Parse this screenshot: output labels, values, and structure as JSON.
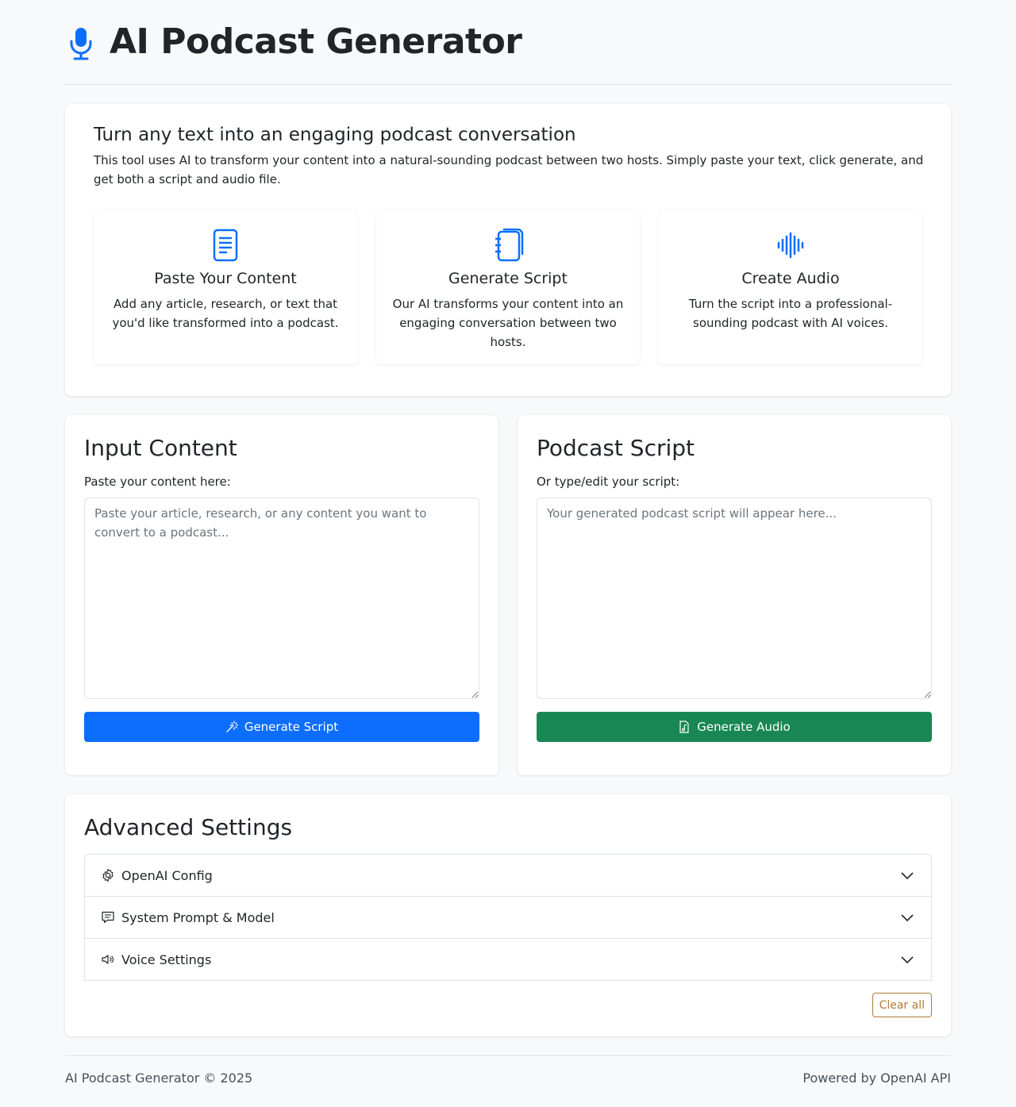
{
  "header": {
    "title": "AI Podcast Generator",
    "icon": "microphone-icon"
  },
  "intro": {
    "heading": "Turn any text into an engaging podcast conversation",
    "description": "This tool uses AI to transform your content into a natural-sounding podcast between two hosts. Simply paste your text, click generate, and get both a script and audio file.",
    "features": [
      {
        "icon": "document-icon",
        "title": "Paste Your Content",
        "text": "Add any article, research, or text that you'd like transformed into a podcast."
      },
      {
        "icon": "journal-icon",
        "title": "Generate Script",
        "text": "Our AI transforms your content into an engaging conversation between two hosts."
      },
      {
        "icon": "soundwave-icon",
        "title": "Create Audio",
        "text": "Turn the script into a professional-sounding podcast with AI voices."
      }
    ]
  },
  "input_panel": {
    "title": "Input Content",
    "label": "Paste your content here:",
    "value": "",
    "placeholder": "Paste your article, research, or any content you want to convert to a podcast...",
    "button_label": "Generate Script",
    "button_icon": "magic-wand-icon"
  },
  "script_panel": {
    "title": "Podcast Script",
    "label": "Or type/edit your script:",
    "value": "",
    "placeholder": "Your generated podcast script will appear here...",
    "button_label": "Generate Audio",
    "button_icon": "file-music-icon"
  },
  "advanced": {
    "title": "Advanced Settings",
    "items": [
      {
        "icon": "gear-icon",
        "label": "OpenAI Config"
      },
      {
        "icon": "chat-square-icon",
        "label": "System Prompt & Model"
      },
      {
        "icon": "volume-icon",
        "label": "Voice Settings"
      }
    ],
    "clear_label": "Clear all"
  },
  "footer": {
    "left": "AI Podcast Generator © 2025",
    "right": "Powered by OpenAI API"
  },
  "colors": {
    "primary": "#0d6efd",
    "success": "#198754",
    "warning_outline": "#b07a3a",
    "background": "#f8f9fa"
  }
}
